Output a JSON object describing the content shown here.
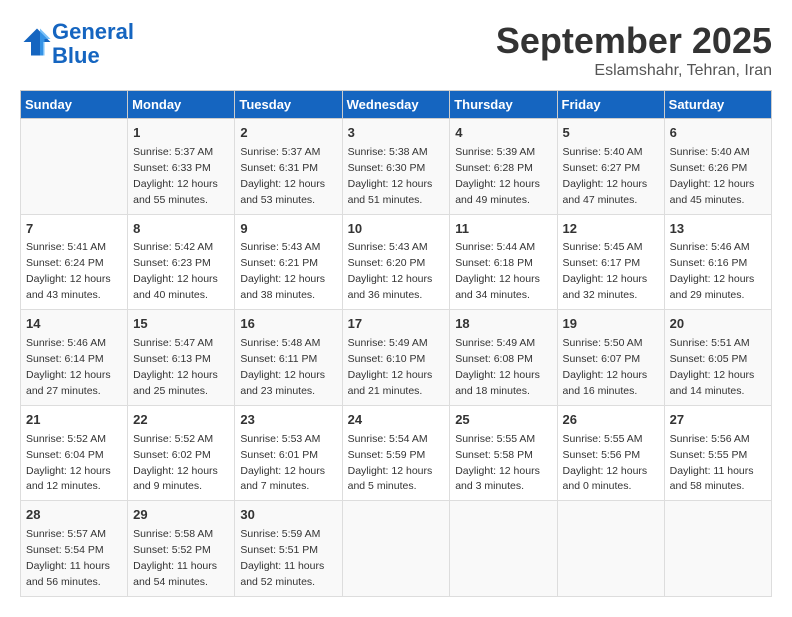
{
  "header": {
    "logo_line1": "General",
    "logo_line2": "Blue",
    "month": "September 2025",
    "location": "Eslamshahr, Tehran, Iran"
  },
  "days_of_week": [
    "Sunday",
    "Monday",
    "Tuesday",
    "Wednesday",
    "Thursday",
    "Friday",
    "Saturday"
  ],
  "weeks": [
    [
      {
        "day": "",
        "info": ""
      },
      {
        "day": "1",
        "info": "Sunrise: 5:37 AM\nSunset: 6:33 PM\nDaylight: 12 hours\nand 55 minutes."
      },
      {
        "day": "2",
        "info": "Sunrise: 5:37 AM\nSunset: 6:31 PM\nDaylight: 12 hours\nand 53 minutes."
      },
      {
        "day": "3",
        "info": "Sunrise: 5:38 AM\nSunset: 6:30 PM\nDaylight: 12 hours\nand 51 minutes."
      },
      {
        "day": "4",
        "info": "Sunrise: 5:39 AM\nSunset: 6:28 PM\nDaylight: 12 hours\nand 49 minutes."
      },
      {
        "day": "5",
        "info": "Sunrise: 5:40 AM\nSunset: 6:27 PM\nDaylight: 12 hours\nand 47 minutes."
      },
      {
        "day": "6",
        "info": "Sunrise: 5:40 AM\nSunset: 6:26 PM\nDaylight: 12 hours\nand 45 minutes."
      }
    ],
    [
      {
        "day": "7",
        "info": "Sunrise: 5:41 AM\nSunset: 6:24 PM\nDaylight: 12 hours\nand 43 minutes."
      },
      {
        "day": "8",
        "info": "Sunrise: 5:42 AM\nSunset: 6:23 PM\nDaylight: 12 hours\nand 40 minutes."
      },
      {
        "day": "9",
        "info": "Sunrise: 5:43 AM\nSunset: 6:21 PM\nDaylight: 12 hours\nand 38 minutes."
      },
      {
        "day": "10",
        "info": "Sunrise: 5:43 AM\nSunset: 6:20 PM\nDaylight: 12 hours\nand 36 minutes."
      },
      {
        "day": "11",
        "info": "Sunrise: 5:44 AM\nSunset: 6:18 PM\nDaylight: 12 hours\nand 34 minutes."
      },
      {
        "day": "12",
        "info": "Sunrise: 5:45 AM\nSunset: 6:17 PM\nDaylight: 12 hours\nand 32 minutes."
      },
      {
        "day": "13",
        "info": "Sunrise: 5:46 AM\nSunset: 6:16 PM\nDaylight: 12 hours\nand 29 minutes."
      }
    ],
    [
      {
        "day": "14",
        "info": "Sunrise: 5:46 AM\nSunset: 6:14 PM\nDaylight: 12 hours\nand 27 minutes."
      },
      {
        "day": "15",
        "info": "Sunrise: 5:47 AM\nSunset: 6:13 PM\nDaylight: 12 hours\nand 25 minutes."
      },
      {
        "day": "16",
        "info": "Sunrise: 5:48 AM\nSunset: 6:11 PM\nDaylight: 12 hours\nand 23 minutes."
      },
      {
        "day": "17",
        "info": "Sunrise: 5:49 AM\nSunset: 6:10 PM\nDaylight: 12 hours\nand 21 minutes."
      },
      {
        "day": "18",
        "info": "Sunrise: 5:49 AM\nSunset: 6:08 PM\nDaylight: 12 hours\nand 18 minutes."
      },
      {
        "day": "19",
        "info": "Sunrise: 5:50 AM\nSunset: 6:07 PM\nDaylight: 12 hours\nand 16 minutes."
      },
      {
        "day": "20",
        "info": "Sunrise: 5:51 AM\nSunset: 6:05 PM\nDaylight: 12 hours\nand 14 minutes."
      }
    ],
    [
      {
        "day": "21",
        "info": "Sunrise: 5:52 AM\nSunset: 6:04 PM\nDaylight: 12 hours\nand 12 minutes."
      },
      {
        "day": "22",
        "info": "Sunrise: 5:52 AM\nSunset: 6:02 PM\nDaylight: 12 hours\nand 9 minutes."
      },
      {
        "day": "23",
        "info": "Sunrise: 5:53 AM\nSunset: 6:01 PM\nDaylight: 12 hours\nand 7 minutes."
      },
      {
        "day": "24",
        "info": "Sunrise: 5:54 AM\nSunset: 5:59 PM\nDaylight: 12 hours\nand 5 minutes."
      },
      {
        "day": "25",
        "info": "Sunrise: 5:55 AM\nSunset: 5:58 PM\nDaylight: 12 hours\nand 3 minutes."
      },
      {
        "day": "26",
        "info": "Sunrise: 5:55 AM\nSunset: 5:56 PM\nDaylight: 12 hours\nand 0 minutes."
      },
      {
        "day": "27",
        "info": "Sunrise: 5:56 AM\nSunset: 5:55 PM\nDaylight: 11 hours\nand 58 minutes."
      }
    ],
    [
      {
        "day": "28",
        "info": "Sunrise: 5:57 AM\nSunset: 5:54 PM\nDaylight: 11 hours\nand 56 minutes."
      },
      {
        "day": "29",
        "info": "Sunrise: 5:58 AM\nSunset: 5:52 PM\nDaylight: 11 hours\nand 54 minutes."
      },
      {
        "day": "30",
        "info": "Sunrise: 5:59 AM\nSunset: 5:51 PM\nDaylight: 11 hours\nand 52 minutes."
      },
      {
        "day": "",
        "info": ""
      },
      {
        "day": "",
        "info": ""
      },
      {
        "day": "",
        "info": ""
      },
      {
        "day": "",
        "info": ""
      }
    ]
  ]
}
